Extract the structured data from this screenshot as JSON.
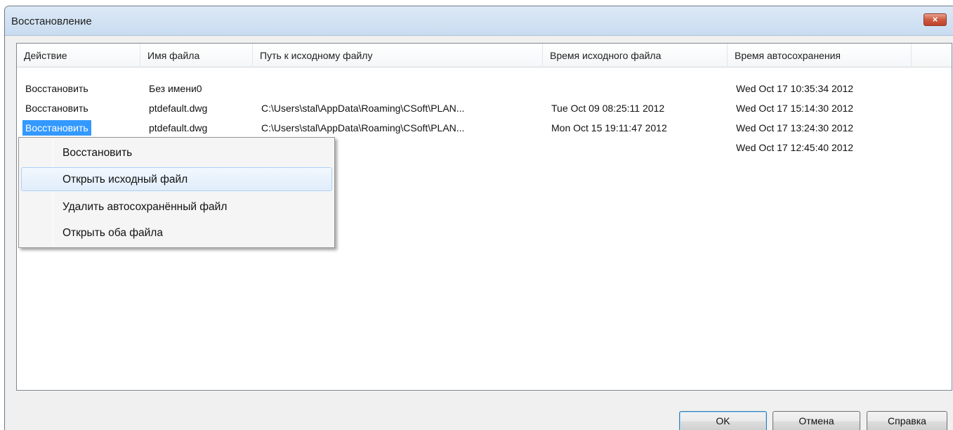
{
  "window": {
    "title": "Восстановление",
    "close_glyph": "×"
  },
  "columns": [
    "Действие",
    "Имя файла",
    "Путь к исходному файлу",
    "Время исходного файла",
    "Время автосохранения"
  ],
  "rows": [
    {
      "action": "Восстановить",
      "filename": "Без имени0",
      "path": "",
      "source_time": "",
      "autosave_time": "Wed Oct 17 10:35:34 2012"
    },
    {
      "action": "Восстановить",
      "filename": "ptdefault.dwg",
      "path": "C:\\Users\\stal\\AppData\\Roaming\\CSoft\\PLAN...",
      "source_time": "Tue Oct 09 08:25:11 2012",
      "autosave_time": "Wed Oct 17 15:14:30 2012"
    },
    {
      "action": "Восстановить",
      "filename": "ptdefault.dwg",
      "path": "C:\\Users\\stal\\AppData\\Roaming\\CSoft\\PLAN...",
      "source_time": "Mon Oct 15 19:11:47 2012",
      "autosave_time": "Wed Oct 17 13:24:30 2012"
    },
    {
      "action": "",
      "filename": "",
      "path": "",
      "source_time": "",
      "autosave_time": "Wed Oct 17 12:45:40 2012"
    }
  ],
  "selected_row": 2,
  "context_menu": {
    "items": [
      "Восстановить",
      "Открыть исходный файл",
      "Удалить автосохранённый файл",
      "Открыть оба файла"
    ],
    "hovered_index": 1
  },
  "buttons": {
    "ok": "OK",
    "cancel": "Отмена",
    "help": "Справка"
  },
  "colors": {
    "selection": "#3399ff",
    "close_button": "#c7462c",
    "menu_hover_border": "#aecff7"
  }
}
